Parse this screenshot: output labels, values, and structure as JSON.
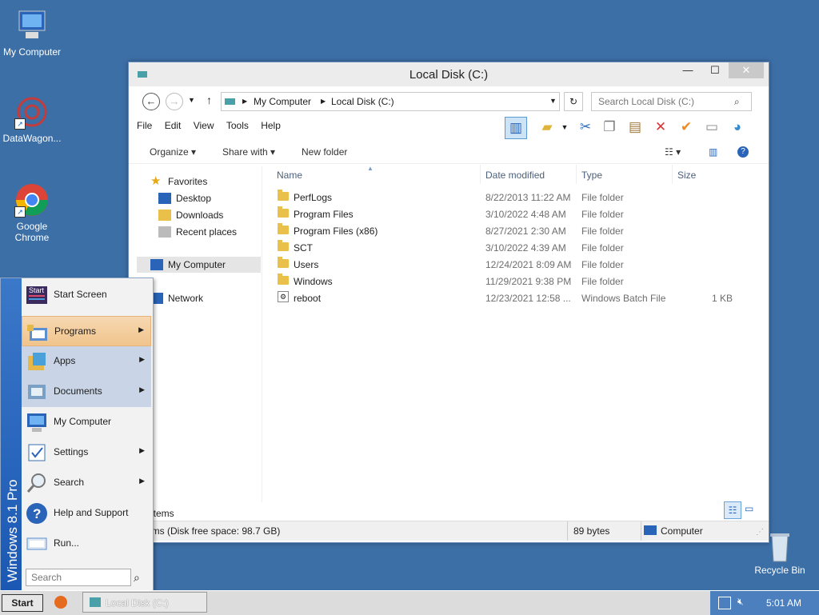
{
  "desktop": {
    "icons": [
      {
        "label": "My Computer"
      },
      {
        "label": "DataWagon..."
      },
      {
        "label": "Google Chrome"
      },
      {
        "label": "Recycle Bin"
      }
    ]
  },
  "window": {
    "title": "Local Disk (C:)",
    "controls": {
      "minimize": "—",
      "maximize": "☐",
      "close": "✕"
    },
    "breadcrumb": [
      "My Computer",
      "Local Disk (C:)"
    ],
    "search_placeholder": "Search Local Disk (C:)",
    "menu": [
      "File",
      "Edit",
      "View",
      "Tools",
      "Help"
    ],
    "commands": {
      "organize": "Organize",
      "share": "Share with",
      "new_folder": "New folder"
    },
    "nav": {
      "favorites": "Favorites",
      "desktop": "Desktop",
      "downloads": "Downloads",
      "recent": "Recent places",
      "computer": "My Computer",
      "network": "Network"
    },
    "columns": {
      "name": "Name",
      "date": "Date modified",
      "type": "Type",
      "size": "Size"
    },
    "files": [
      {
        "name": "PerfLogs",
        "date": "8/22/2013 11:22 AM",
        "type": "File folder",
        "size": ""
      },
      {
        "name": "Program Files",
        "date": "3/10/2022 4:48 AM",
        "type": "File folder",
        "size": ""
      },
      {
        "name": "Program Files (x86)",
        "date": "8/27/2021 2:30 AM",
        "type": "File folder",
        "size": ""
      },
      {
        "name": "SCT",
        "date": "3/10/2022 4:39 AM",
        "type": "File folder",
        "size": ""
      },
      {
        "name": "Users",
        "date": "12/24/2021 8:09 AM",
        "type": "File folder",
        "size": ""
      },
      {
        "name": "Windows",
        "date": "11/29/2021 9:38 PM",
        "type": "File folder",
        "size": ""
      },
      {
        "name": "reboot",
        "date": "12/23/2021 12:58 ...",
        "type": "Windows Batch File",
        "size": "1 KB"
      }
    ],
    "status": {
      "items": "items",
      "free": "ems (Disk free space: 98.7 GB)",
      "bytes": "89 bytes",
      "location": "Computer"
    }
  },
  "startmenu": {
    "brand": "Windows 8.1 Pro",
    "items": [
      {
        "label": "Start Screen",
        "arrow": ""
      },
      {
        "label": "Programs",
        "arrow": "▶"
      },
      {
        "label": "Apps",
        "arrow": "▶"
      },
      {
        "label": "Documents",
        "arrow": "▶"
      },
      {
        "label": "My Computer",
        "arrow": ""
      },
      {
        "label": "Settings",
        "arrow": "▶"
      },
      {
        "label": "Search",
        "arrow": "▶"
      },
      {
        "label": "Help and Support",
        "arrow": ""
      },
      {
        "label": "Run...",
        "arrow": ""
      }
    ],
    "search_placeholder": "Search",
    "start_tile_text": "Start"
  },
  "taskbar": {
    "start_label": "Start",
    "task_label": "Local Disk (C:)",
    "clock": "5:01 AM"
  }
}
